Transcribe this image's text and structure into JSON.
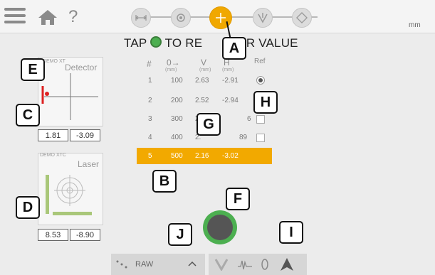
{
  "topbar": {
    "help": "?",
    "unit": "mm",
    "steps": [
      {
        "icon": "distance-icon"
      },
      {
        "icon": "rotate-icon"
      },
      {
        "icon": "crosshair-icon",
        "active": true
      },
      {
        "icon": "adjust-icon"
      },
      {
        "icon": "report-icon"
      }
    ]
  },
  "prompt": {
    "pre": "TAP",
    "post": "TO RE",
    "tail": "ER VALUE"
  },
  "callouts": {
    "A": "A",
    "B": "B",
    "C": "C",
    "D": "D",
    "E": "E",
    "F": "F",
    "G": "G",
    "H": "H",
    "I": "I",
    "J": "J"
  },
  "detector": {
    "title": "Detector",
    "demo": "DEMO XT",
    "v_value": "1.81",
    "h_value": "-3.09"
  },
  "laser": {
    "title": "Laser",
    "demo": "DEMO XTC",
    "x_value": "8.53",
    "y_value": "-8.90"
  },
  "table": {
    "headers": [
      "#",
      "0→",
      "V",
      "H",
      "Ref"
    ],
    "subheaders": [
      "",
      "(mm)",
      "(mm)",
      "(mm)",
      ""
    ],
    "rows": [
      {
        "n": "1",
        "d": "100",
        "v": "2.63",
        "h": "-2.91"
      },
      {
        "n": "2",
        "d": "200",
        "v": "2.52",
        "h": "-2.94"
      },
      {
        "n": "3",
        "d": "300",
        "v": "2",
        "h": "6"
      },
      {
        "n": "4",
        "d": "400",
        "v": "2.",
        "h": "89"
      },
      {
        "n": "5",
        "d": "500",
        "v": "2.16",
        "h": "-3.02"
      }
    ]
  },
  "bottom": {
    "raw_label": "RAW"
  },
  "colors": {
    "accent": "#f0a800",
    "record": "#4caf50"
  }
}
